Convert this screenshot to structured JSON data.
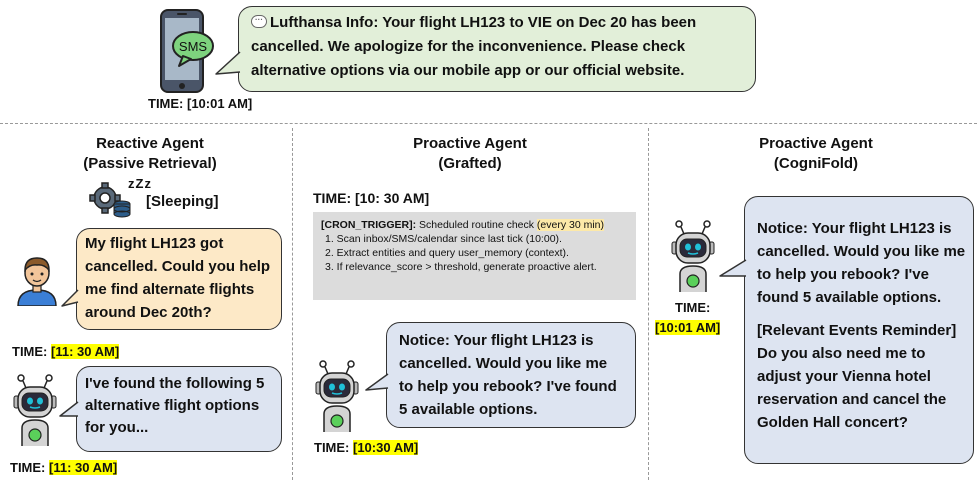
{
  "colors": {
    "sms_bubble": "#e2efd9",
    "user_bubble": "#fde9c7",
    "agent_bubble": "#dde4f1",
    "highlight": "#ffff00",
    "robot_eye": "#20c0d8"
  },
  "sms": {
    "icon_label": "SMS",
    "message": "Lufthansa Info: Your flight LH123 to VIE on Dec 20 has been cancelled. We apologize for the inconvenience. Please check alternative options via our mobile app or our official website.",
    "time": "TIME: [10:01 AM]"
  },
  "reactive": {
    "title_line1": "Reactive Agent",
    "title_line2": "(Passive Retrieval)",
    "sleep_icon": "zZz",
    "status": "[Sleeping]",
    "user_message": "My flight LH123 got cancelled. Could you help me find alternate flights around Dec 20th?",
    "user_time_prefix": "TIME: ",
    "user_time_value": "[11: 30 AM]",
    "agent_message": "I've found the following 5 alternative flight options for you...",
    "agent_time_prefix": "TIME: ",
    "agent_time_value": "[11: 30 AM]"
  },
  "grafted": {
    "title_line1": "Proactive Agent",
    "title_line2": "(Grafted)",
    "time": "TIME: [10: 30 AM]",
    "cron_tag": "[CRON_TRIGGER]:",
    "cron_text": " Scheduled routine check ",
    "cron_highlight": "(every 30 min)",
    "steps": [
      "1. Scan inbox/SMS/calendar since last tick (10:00).",
      "2. Extract entities and query user_memory (context).",
      "3. If relevance_score > threshold, generate proactive alert."
    ],
    "agent_message": "Notice: Your flight LH123 is cancelled. Would you like me to help you rebook? I've found 5 available options.",
    "agent_time_prefix": "TIME: ",
    "agent_time_value": "[10:30 AM]"
  },
  "cognifold": {
    "title_line1": "Proactive Agent",
    "title_line2": "(CogniFold)",
    "time_label": "TIME:",
    "time_value": "[10:01 AM]",
    "agent_message": "Notice: Your flight LH123 is cancelled. Would you like me to help you rebook? I've found 5 available options.",
    "reminder_message": "[Relevant Events Reminder] Do you also need me to adjust your Vienna hotel reservation and cancel the Golden Hall concert?"
  }
}
